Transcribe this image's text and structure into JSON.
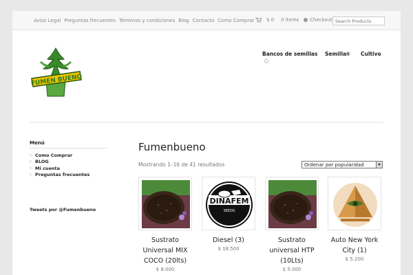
{
  "topbar": {
    "links": [
      "Aviso Legal",
      "Preguntas frecuentes",
      "Términos y condiciones",
      "Blog",
      "Contacto",
      "Como Comprar"
    ],
    "cart_amount": "$ 0",
    "cart_items": "0 items",
    "checkout_label": "Checkout",
    "search_placeholder": "Search Products"
  },
  "header": {
    "logo_text": "FUMEN BUENO",
    "nav": [
      "Bancos de semillas",
      "Semillas",
      "Cultivo"
    ]
  },
  "sidebar": {
    "menu_title": "Menú",
    "menu_items": [
      "Como Comprar",
      "BLOG",
      "Mi cuenta",
      "Preguntas frecuentes"
    ],
    "tweets_title": "Tweets por @Fumenbueno"
  },
  "main": {
    "title": "Fumenbueno",
    "result_count": "Mostrando 1–16 de 41 resultados",
    "sort_selected": "Ordenar por popularidad",
    "products": [
      {
        "name": "Sustrato Universal MIX COCO (20lts)",
        "price": "$ 8.000",
        "image": "soil-image"
      },
      {
        "name": "Diesel (3)",
        "price": "$ 18.500",
        "image": "dinafem-logo"
      },
      {
        "name": "Sustrato universal HTP (10Lts)",
        "price": "$ 5.000",
        "image": "soil-image"
      },
      {
        "name": "Auto New York City (1)",
        "price": "$ 5.200",
        "image": "pyramid-seeds-logo"
      }
    ]
  },
  "colors": {
    "background": "#e8e8e8",
    "topbar": "#f7f7f7",
    "text": "#222222",
    "muted": "#777777",
    "logo_green": "#3a8a2a",
    "logo_yellow": "#e8c400"
  }
}
